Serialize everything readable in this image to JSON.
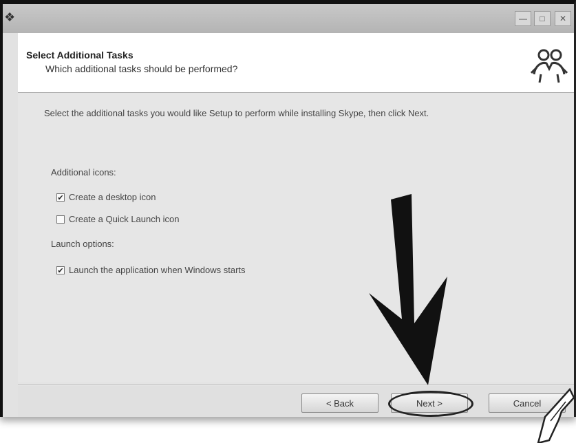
{
  "window": {
    "title": "",
    "controls": {
      "minimize": "—",
      "maximize": "□",
      "close": "✕"
    }
  },
  "header": {
    "title": "Select Additional Tasks",
    "subtitle": "Which additional tasks should be performed?",
    "logo_icon": "skype-people-icon"
  },
  "body": {
    "instruction": "Select the additional tasks you would like Setup to perform while installing Skype, then click Next.",
    "additional_icons_label": "Additional icons:",
    "options": [
      {
        "label": "Create a desktop icon",
        "checked": true
      },
      {
        "label": "Create a Quick Launch icon",
        "checked": false
      }
    ],
    "launch_options_label": "Launch options:",
    "launch_options": [
      {
        "label": "Launch the application when Windows starts",
        "checked": true
      }
    ]
  },
  "footer": {
    "back_label": "< Back",
    "next_label": "Next >",
    "cancel_label": "Cancel"
  },
  "annotations": {
    "arrow": "down-arrow-icon",
    "cursor": "mouse-cursor-icon"
  },
  "colors": {
    "window_bg": "#e4e4e4",
    "header_bg": "#ffffff",
    "annotation": "#111111"
  }
}
